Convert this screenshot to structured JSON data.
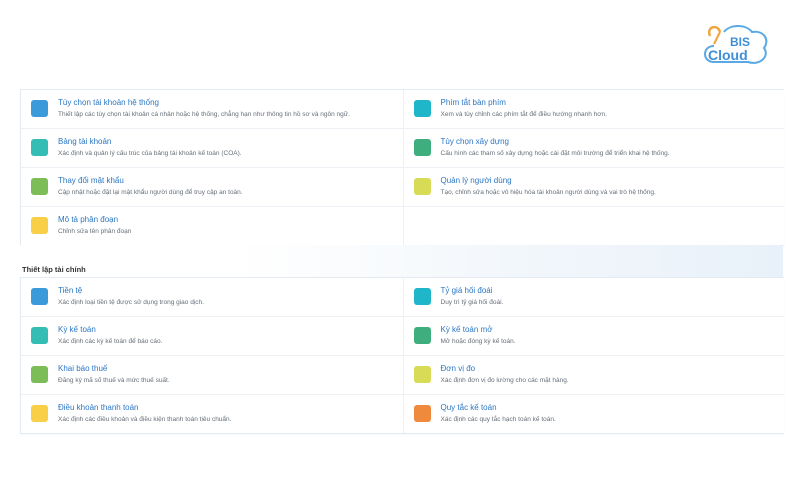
{
  "logo": {
    "line1": "BIS",
    "line2": "Cloud"
  },
  "system_settings": {
    "rows": [
      [
        {
          "title": "Tùy chọn tài khoản hệ thống",
          "desc": "Thiết lập các tùy chọn tài khoản cá nhân hoặc hệ thống, chẳng hạn như thông tin hồ sơ và ngôn ngữ.",
          "color": "#3b9ad9",
          "name": "system-account-options"
        },
        {
          "title": "Phím tắt bàn phím",
          "desc": "Xem và tùy chỉnh các phím tắt để điều hướng nhanh hơn.",
          "color": "#1fb6c9",
          "name": "keyboard-shortcuts"
        }
      ],
      [
        {
          "title": "Bảng tài khoản",
          "desc": "Xác định và quản lý cấu trúc của bảng tài khoản kế toán (COA).",
          "color": "#34bdb4",
          "name": "chart-of-accounts"
        },
        {
          "title": "Tùy chọn xây dựng",
          "desc": "Cấu hình các tham số xây dựng hoặc cài đặt môi trường để triển khai hệ thống.",
          "color": "#3fae7f",
          "name": "build-options"
        }
      ],
      [
        {
          "title": "Thay đổi mật khẩu",
          "desc": "Cập nhật hoặc đặt lại mật khẩu người dùng để truy cập an toàn.",
          "color": "#7cbd57",
          "name": "change-password"
        },
        {
          "title": "Quản lý người dùng",
          "desc": "Tạo, chỉnh sửa hoặc vô hiệu hóa tài khoản người dùng và vai trò hệ thống.",
          "color": "#d7db55",
          "name": "user-management"
        }
      ],
      [
        {
          "title": "Mô tả phân đoạn",
          "desc": "Chỉnh sửa tên phân đoạn",
          "color": "#f8cf47",
          "name": "segment-description"
        },
        null
      ]
    ]
  },
  "finance_section": {
    "label": "Thiết lập tài chính"
  },
  "finance_settings": {
    "rows": [
      [
        {
          "title": "Tiền tệ",
          "desc": "Xác định loại tiền tệ được sử dụng trong giao dịch.",
          "color": "#3b9ad9",
          "name": "currency"
        },
        {
          "title": "Tỷ giá hối đoái",
          "desc": "Duy trì tỷ giá hối đoái.",
          "color": "#1fb6c9",
          "name": "exchange-rate"
        }
      ],
      [
        {
          "title": "Kỳ kế toán",
          "desc": "Xác định các kỳ kế toán để báo cáo.",
          "color": "#34bdb4",
          "name": "accounting-period"
        },
        {
          "title": "Kỳ kế toán mở",
          "desc": "Mở hoặc đóng kỳ kế toán.",
          "color": "#3fae7f",
          "name": "open-accounting-period"
        }
      ],
      [
        {
          "title": "Khai báo thuế",
          "desc": "Đăng ký mã số thuế và mức thuế suất.",
          "color": "#7cbd57",
          "name": "tax-declaration"
        },
        {
          "title": "Đơn vị đo",
          "desc": "Xác định đơn vị đo lường cho các mặt hàng.",
          "color": "#d7db55",
          "name": "unit-of-measure"
        }
      ],
      [
        {
          "title": "Điều khoản thanh toán",
          "desc": "Xác định các điều khoản và điều kiện thanh toán tiêu chuẩn.",
          "color": "#f8cf47",
          "name": "payment-terms"
        },
        {
          "title": "Quy tắc kế toán",
          "desc": "Xác định các quy tắc hạch toán kế toán.",
          "color": "#ef8a3d",
          "name": "accounting-rules"
        }
      ]
    ]
  }
}
